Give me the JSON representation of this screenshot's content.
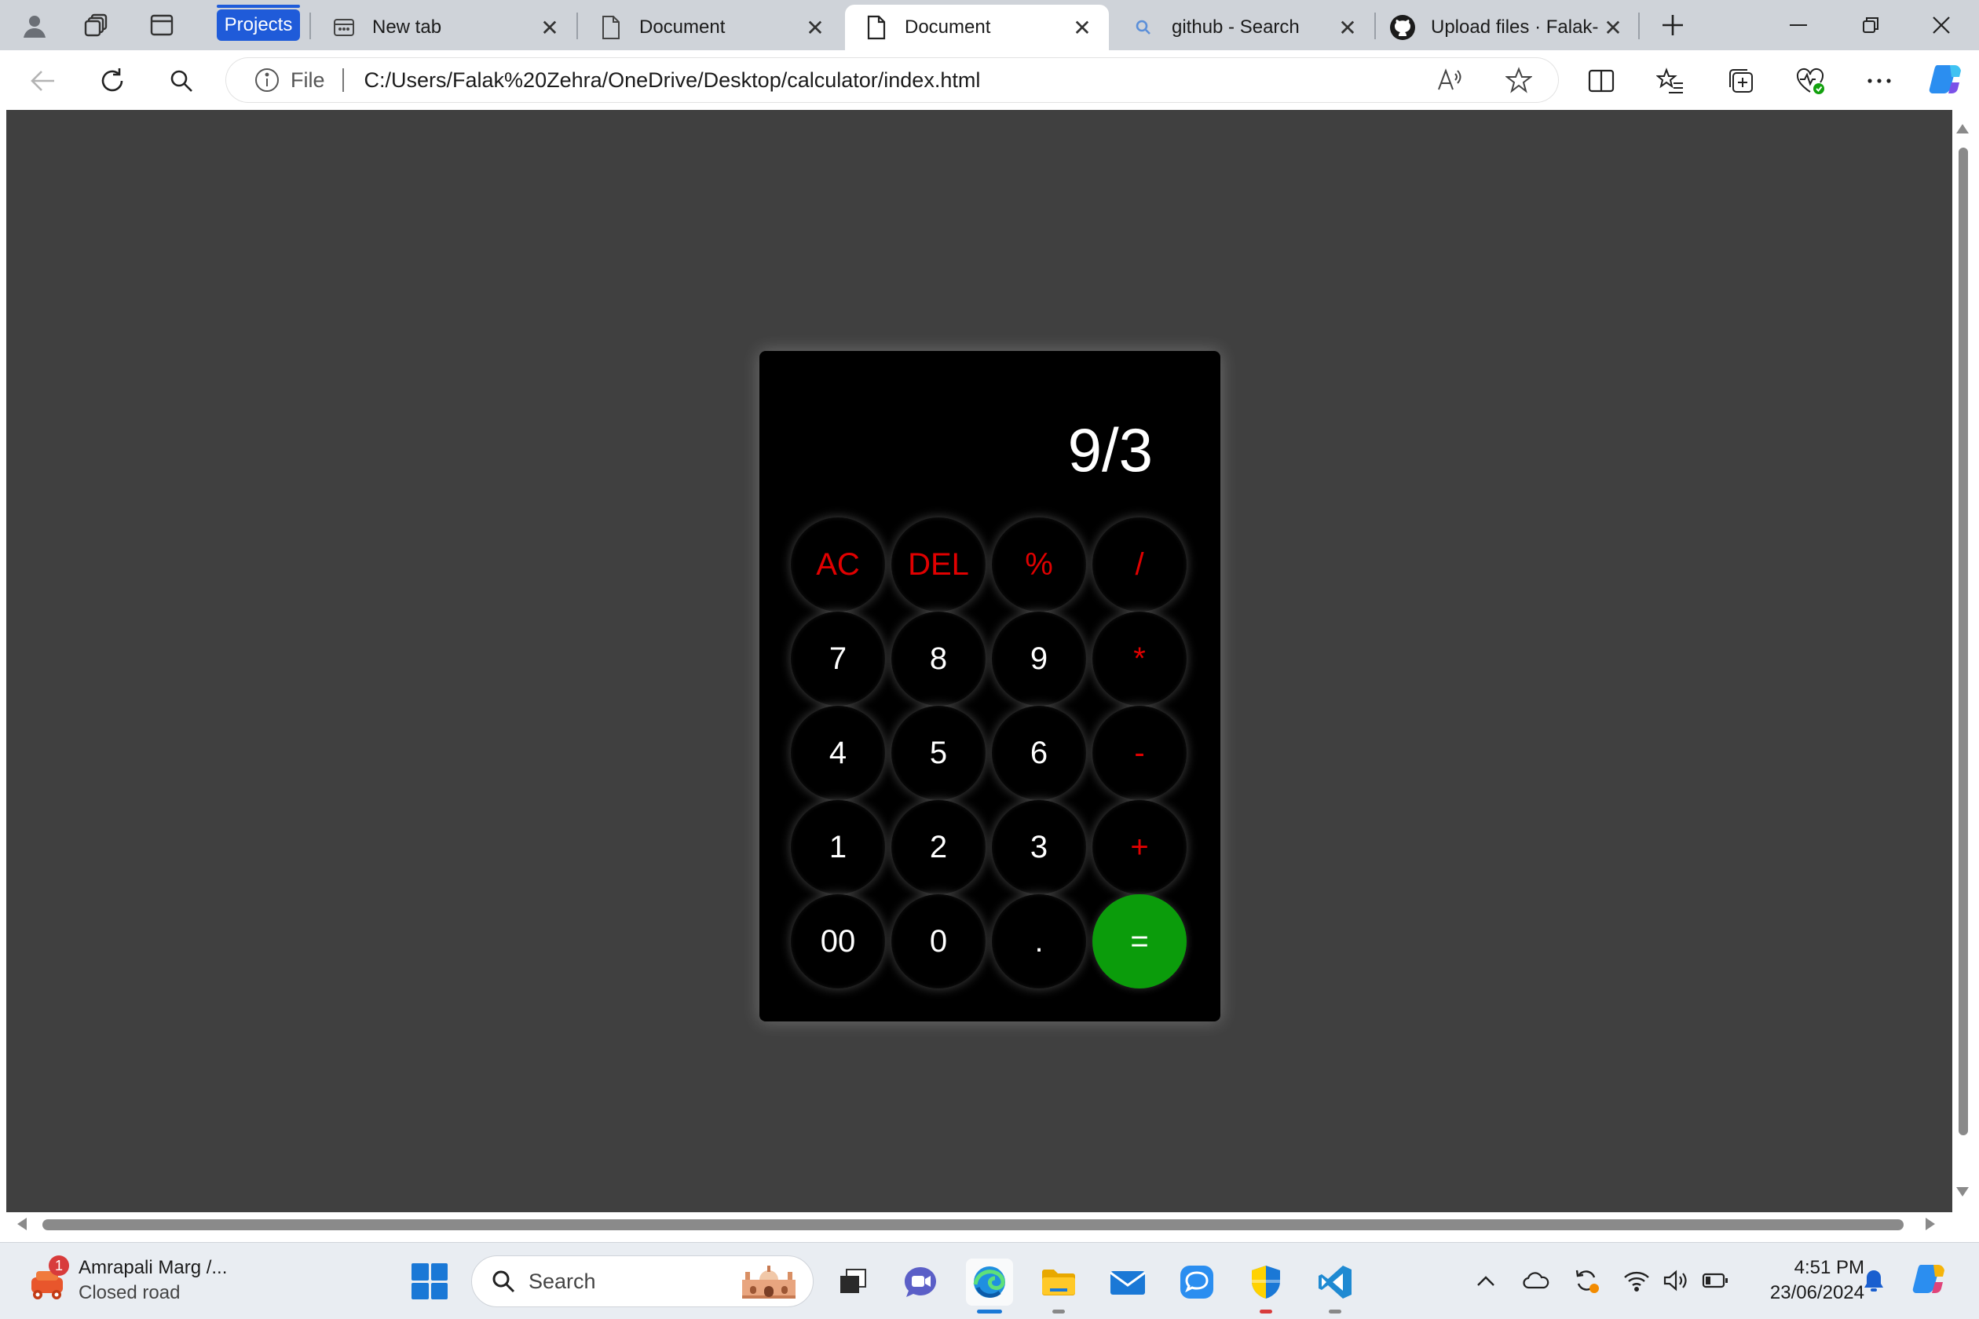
{
  "browser": {
    "tab_group_label": "Projects",
    "tabs": [
      {
        "title": "New tab",
        "icon": "new-tab-icon"
      },
      {
        "title": "Document",
        "icon": "document-icon"
      },
      {
        "title": "Document",
        "icon": "document-icon",
        "active": true
      },
      {
        "title": "github - Search",
        "icon": "search-icon"
      },
      {
        "title": "Upload files · Falak-",
        "icon": "github-icon"
      }
    ],
    "address": {
      "scheme_label": "File",
      "url": "C:/Users/Falak%20Zehra/OneDrive/Desktop/calculator/index.html"
    }
  },
  "calculator": {
    "display": "9/3",
    "keys": [
      {
        "label": "AC",
        "style": "red"
      },
      {
        "label": "DEL",
        "style": "red"
      },
      {
        "label": "%",
        "style": "red"
      },
      {
        "label": "/",
        "style": "red"
      },
      {
        "label": "7",
        "style": "white"
      },
      {
        "label": "8",
        "style": "white"
      },
      {
        "label": "9",
        "style": "white"
      },
      {
        "label": "*",
        "style": "red"
      },
      {
        "label": "4",
        "style": "white"
      },
      {
        "label": "5",
        "style": "white"
      },
      {
        "label": "6",
        "style": "white"
      },
      {
        "label": "-",
        "style": "red"
      },
      {
        "label": "1",
        "style": "white"
      },
      {
        "label": "2",
        "style": "white"
      },
      {
        "label": "3",
        "style": "white"
      },
      {
        "label": "+",
        "style": "red"
      },
      {
        "label": "00",
        "style": "white"
      },
      {
        "label": "0",
        "style": "white"
      },
      {
        "label": ".",
        "style": "white"
      },
      {
        "label": "=",
        "style": "green"
      }
    ],
    "colors": {
      "operator": "#e00000",
      "equals": "#0b9c0b",
      "background": "#000000",
      "page": "#404040"
    }
  },
  "taskbar": {
    "weather": {
      "badge": "1",
      "title": "Amrapali Marg /...",
      "subtitle": "Closed road"
    },
    "search_placeholder": "Search",
    "clock": {
      "time": "4:51 PM",
      "date": "23/06/2024"
    }
  }
}
